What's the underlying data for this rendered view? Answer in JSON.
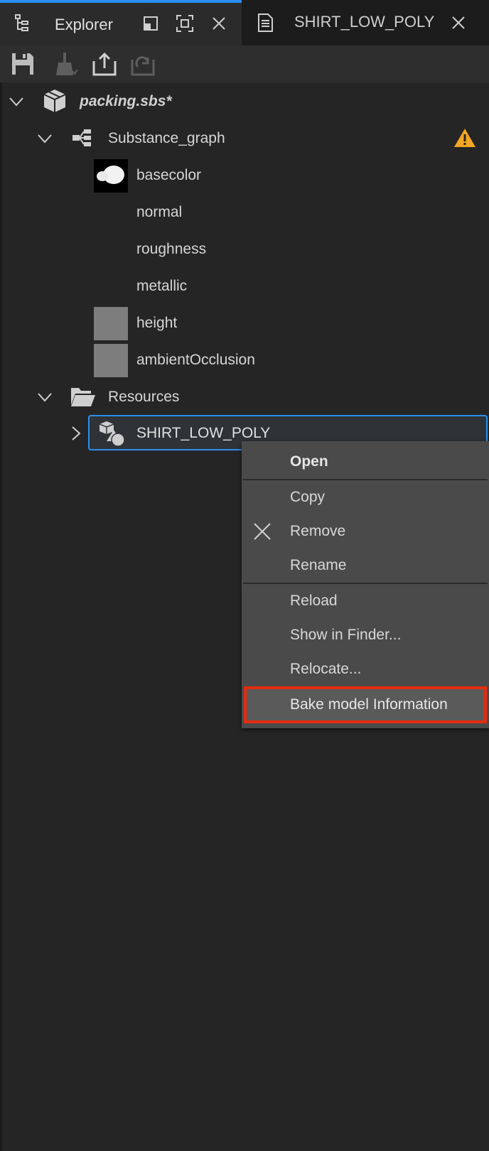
{
  "tabs": {
    "explorer_label": "Explorer",
    "resource_label": "SHIRT_LOW_POLY"
  },
  "colors": {
    "accent": "#2a8ff0",
    "highlight_border": "#e52b10",
    "warning": "#f5a623"
  },
  "toolbar": {
    "icons": [
      "save-icon",
      "clean-icon",
      "export-icon",
      "reload-icon"
    ]
  },
  "tree": {
    "package": "packing.sbs*",
    "graph": "Substance_graph",
    "outputs": [
      "basecolor",
      "normal",
      "roughness",
      "metallic",
      "height",
      "ambientOcclusion"
    ],
    "resources_folder": "Resources",
    "resource_item": "SHIRT_LOW_POLY"
  },
  "context_menu": {
    "open": "Open",
    "copy": "Copy",
    "remove": "Remove",
    "rename": "Rename",
    "reload": "Reload",
    "show_in_finder": "Show in Finder...",
    "relocate": "Relocate...",
    "bake": "Bake model Information"
  }
}
